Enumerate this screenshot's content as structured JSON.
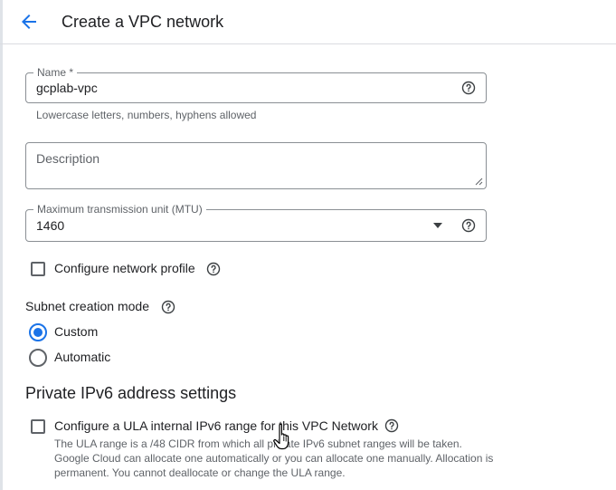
{
  "header": {
    "back_icon": "arrow-left-icon",
    "title": "Create a VPC network"
  },
  "form": {
    "name": {
      "label": "Name *",
      "value": "gcplab-vpc",
      "hint": "Lowercase letters, numbers, hyphens allowed",
      "help_icon": "help-circle-icon"
    },
    "description": {
      "placeholder": "Description",
      "value": ""
    },
    "mtu": {
      "label": "Maximum transmission unit (MTU)",
      "value": "1460",
      "dropdown_icon": "caret-down-icon",
      "help_icon": "help-circle-icon"
    },
    "network_profile": {
      "label": "Configure network profile",
      "checked": false
    },
    "subnet_mode": {
      "label": "Subnet creation mode",
      "options": [
        {
          "label": "Custom",
          "selected": true
        },
        {
          "label": "Automatic",
          "selected": false
        }
      ]
    },
    "ipv6": {
      "heading": "Private IPv6 address settings",
      "checkbox_label": "Configure a ULA internal IPv6 range for this VPC Network",
      "checked": false,
      "description": "The ULA range is a /48 CIDR from which all private IPv6 subnet ranges will be taken. Google Cloud can allocate one automatically or you can allocate one manually. Allocation is permanent. You cannot deallocate or change the ULA range."
    }
  },
  "colors": {
    "accent": "#1a73e8",
    "text": "#202124",
    "secondary_text": "#5f6368",
    "border": "#8a8f94"
  }
}
